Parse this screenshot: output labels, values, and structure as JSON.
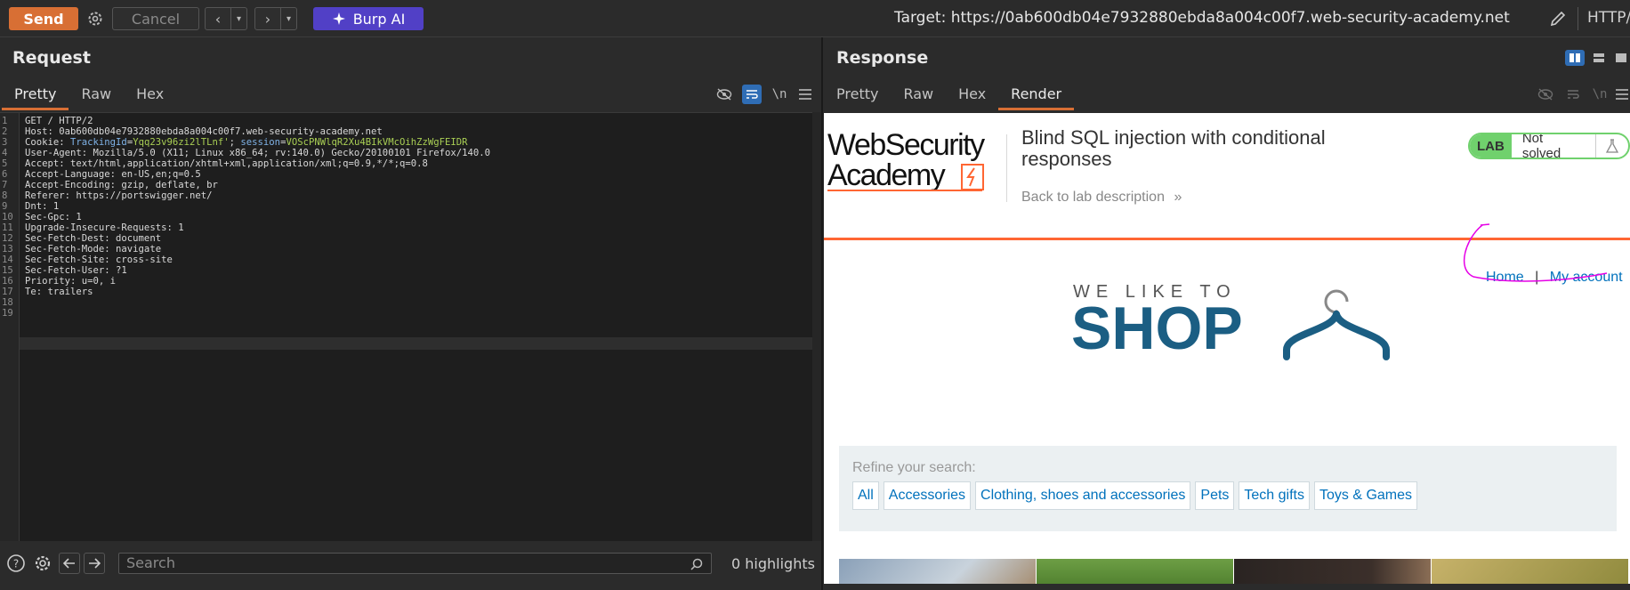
{
  "toolbar": {
    "send": "Send",
    "cancel": "Cancel",
    "burp_ai": "Burp AI",
    "target": "Target: https://0ab600db04e7932880ebda8a004c00f7.web-security-academy.net",
    "protocol": "HTTP/"
  },
  "request": {
    "title": "Request",
    "tabs": [
      "Pretty",
      "Raw",
      "Hex"
    ],
    "active_tab": "Pretty",
    "lines": [
      {
        "n": "1",
        "text": "GET / HTTP/2"
      },
      {
        "n": "2",
        "text": "Host: 0ab600db04e7932880ebda8a004c00f7.web-security-academy.net"
      },
      {
        "n": "3",
        "key": "Cookie: ",
        "c1name": "TrackingId",
        "c1val": "Yqq23v96zi2lTLnf'",
        "sep": "; ",
        "c2name": "session",
        "c2val": "VOScPNWlqR2Xu4BIkVMcOihZzWgFEIDR"
      },
      {
        "n": "4",
        "text": "User-Agent: Mozilla/5.0 (X11; Linux x86_64; rv:140.0) Gecko/20100101 Firefox/140.0"
      },
      {
        "n": "5",
        "text": "Accept: text/html,application/xhtml+xml,application/xml;q=0.9,*/*;q=0.8"
      },
      {
        "n": "6",
        "text": "Accept-Language: en-US,en;q=0.5"
      },
      {
        "n": "7",
        "text": "Accept-Encoding: gzip, deflate, br"
      },
      {
        "n": "8",
        "text": "Referer: https://portswigger.net/"
      },
      {
        "n": "9",
        "text": "Dnt: 1"
      },
      {
        "n": "10",
        "text": "Sec-Gpc: 1"
      },
      {
        "n": "11",
        "text": "Upgrade-Insecure-Requests: 1"
      },
      {
        "n": "12",
        "text": "Sec-Fetch-Dest: document"
      },
      {
        "n": "13",
        "text": "Sec-Fetch-Mode: navigate"
      },
      {
        "n": "14",
        "text": "Sec-Fetch-Site: cross-site"
      },
      {
        "n": "15",
        "text": "Sec-Fetch-User: ?1"
      },
      {
        "n": "16",
        "text": "Priority: u=0, i"
      },
      {
        "n": "17",
        "text": "Te: trailers"
      },
      {
        "n": "18",
        "text": ""
      },
      {
        "n": "19",
        "text": ""
      }
    ],
    "search_placeholder": "Search",
    "highlights": "0 highlights"
  },
  "response": {
    "title": "Response",
    "tabs": [
      "Pretty",
      "Raw",
      "Hex",
      "Render"
    ],
    "active_tab": "Render",
    "page": {
      "logo_line1": "WebSecurity",
      "logo_line2": "Academy",
      "lab_title": "Blind SQL injection with conditional responses",
      "back_link": "Back to lab description",
      "lab_label": "LAB",
      "lab_status": "Not solved",
      "nav_home": "Home",
      "nav_sep": "|",
      "nav_account": "My account",
      "hero_small": "WE LIKE TO",
      "hero_big": "SHOP",
      "refine_label": "Refine your search:",
      "categories": [
        "All",
        "Accessories",
        "Clothing, shoes and accessories",
        "Pets",
        "Tech gifts",
        "Toys & Games"
      ]
    }
  },
  "colors": {
    "send": "#d86f34",
    "burp_ai": "#5140c6",
    "tab_active_underline": "#d86f34",
    "cookie_name": "#7fb2e6",
    "cookie_value": "#a9cf54",
    "link": "#0071bc",
    "lab_green": "#70d16d",
    "academy_orange": "#ff6633",
    "shop_blue": "#1b5e83",
    "annotation": "#e600e6"
  }
}
